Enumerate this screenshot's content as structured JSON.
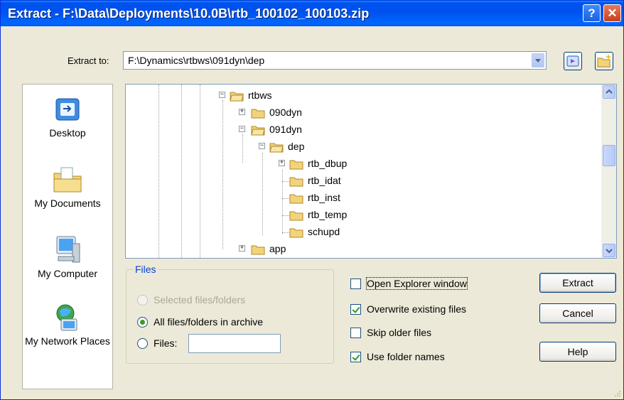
{
  "window": {
    "title": "Extract - F:\\Data\\Deployments\\10.0B\\rtb_100102_100103.zip",
    "help_glyph": "?",
    "close_glyph": "✕"
  },
  "extract_to": {
    "label": "Extract to:",
    "value": "F:\\Dynamics\\rtbws\\091dyn\\dep"
  },
  "places": [
    {
      "label": "Desktop",
      "icon": "desktop-icon"
    },
    {
      "label": "My Documents",
      "icon": "my-documents-icon"
    },
    {
      "label": "My Computer",
      "icon": "my-computer-icon"
    },
    {
      "label": "My Network Places",
      "icon": "network-places-icon"
    }
  ],
  "tree": [
    {
      "label": "rtbws",
      "expander": "minus",
      "open": true
    },
    {
      "label": "090dyn",
      "expander": "plus",
      "open": false
    },
    {
      "label": "091dyn",
      "expander": "minus",
      "open": true
    },
    {
      "label": "dep",
      "expander": "minus",
      "open": true
    },
    {
      "label": "rtb_dbup",
      "expander": "plus",
      "open": false
    },
    {
      "label": "rtb_idat",
      "expander": "",
      "open": false
    },
    {
      "label": "rtb_inst",
      "expander": "",
      "open": false
    },
    {
      "label": "rtb_temp",
      "expander": "",
      "open": false
    },
    {
      "label": "schupd",
      "expander": "",
      "open": false
    },
    {
      "label": "app",
      "expander": "plus",
      "open": false
    }
  ],
  "files_group": {
    "legend": "Files",
    "selected_label": "Selected files/folders",
    "all_label": "All files/folders in archive",
    "files_label": "Files:",
    "files_value": ""
  },
  "options": {
    "open_explorer": "Open Explorer window",
    "overwrite": "Overwrite existing files",
    "skip_older": "Skip older files",
    "use_folder_names": "Use folder names"
  },
  "buttons": {
    "extract": "Extract",
    "cancel": "Cancel",
    "help": "Help"
  },
  "colors": {
    "titlebar": "#0053ee",
    "dialog_bg": "#ece9d8",
    "group_legend": "#0046d5",
    "check_mark": "#21a121",
    "folder": "#f3d37a"
  }
}
